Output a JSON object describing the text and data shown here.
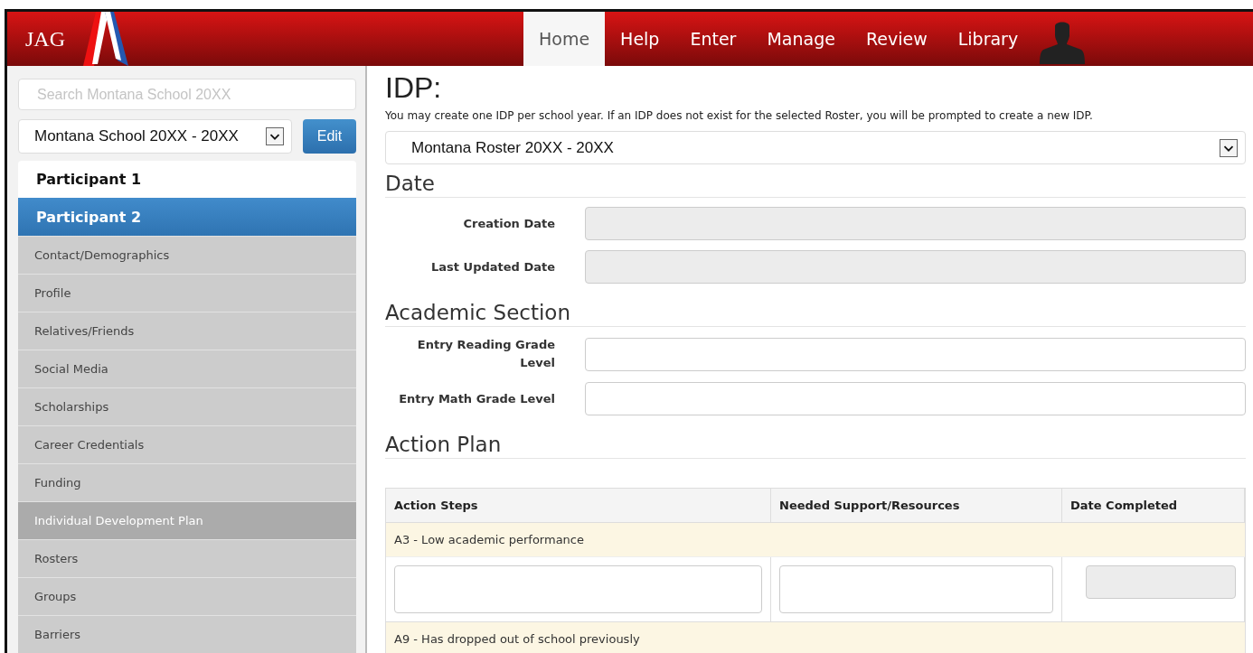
{
  "header": {
    "logo": "JAG",
    "nav": [
      {
        "label": "Home",
        "selected": true
      },
      {
        "label": "Help",
        "selected": false
      },
      {
        "label": "Enter",
        "selected": false
      },
      {
        "label": "Manage",
        "selected": false
      },
      {
        "label": "Review",
        "selected": false
      },
      {
        "label": "Library",
        "selected": false
      }
    ]
  },
  "sidebar": {
    "search": {
      "placeholder": "Search Montana School 20XX"
    },
    "school_select": {
      "value": "Montana School 20XX - 20XX"
    },
    "edit_button": "Edit",
    "participants": [
      {
        "label": "Participant 1",
        "selected": false
      },
      {
        "label": "Participant 2",
        "selected": true
      }
    ],
    "items": [
      {
        "label": "Contact/Demographics",
        "selected": false
      },
      {
        "label": "Profile",
        "selected": false
      },
      {
        "label": "Relatives/Friends",
        "selected": false
      },
      {
        "label": "Social Media",
        "selected": false
      },
      {
        "label": "Scholarships",
        "selected": false
      },
      {
        "label": "Career Credentials",
        "selected": false
      },
      {
        "label": "Funding",
        "selected": false
      },
      {
        "label": "Individual Development Plan",
        "selected": true
      },
      {
        "label": "Rosters",
        "selected": false
      },
      {
        "label": "Groups",
        "selected": false
      },
      {
        "label": "Barriers",
        "selected": false
      }
    ]
  },
  "main": {
    "title": "IDP:",
    "note": "You may create one IDP per school year. If an IDP does not exist for the selected Roster, you will be prompted to create a new IDP.",
    "roster_select": {
      "value": "Montana Roster 20XX - 20XX"
    },
    "sections": [
      {
        "heading": "Date",
        "fields": [
          {
            "label": "Creation Date",
            "disabled": true
          },
          {
            "label": "Last Updated Date",
            "disabled": true
          }
        ]
      },
      {
        "heading": "Academic Section",
        "fields": [
          {
            "label": "Entry Reading Grade Level",
            "disabled": false
          },
          {
            "label": "Entry Math Grade Level",
            "disabled": false
          }
        ]
      }
    ],
    "action_plan": {
      "heading": "Action Plan",
      "columns": [
        "Action Steps",
        "Needed Support/Resources",
        "Date Completed"
      ],
      "groups": [
        {
          "label": "A3 - Low academic performance"
        },
        {
          "label": "A9 - Has dropped out of school previously"
        }
      ]
    }
  }
}
